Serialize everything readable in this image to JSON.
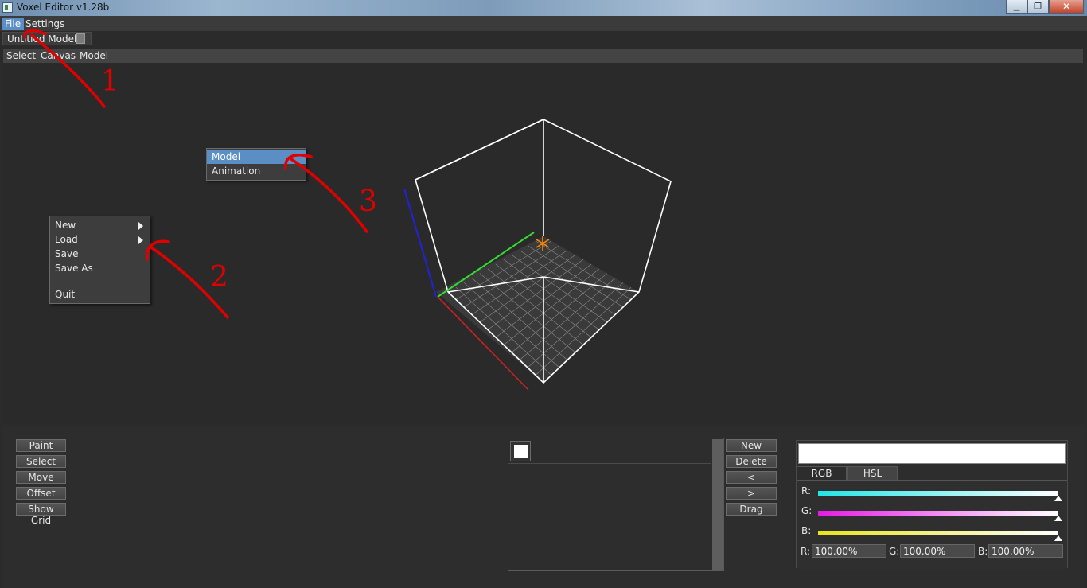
{
  "window": {
    "title": "Voxel Editor v1.28b"
  },
  "menubar": {
    "file": "File",
    "settings": "Settings"
  },
  "document_tab": {
    "title": "Untitled Model"
  },
  "tool_menu": {
    "select": "Select",
    "canvas": "Canvas",
    "model": "Model"
  },
  "file_menu": {
    "new": "New",
    "load": "Load",
    "save": "Save",
    "save_as": "Save As",
    "quit": "Quit"
  },
  "load_submenu": {
    "model": "Model",
    "animation": "Animation"
  },
  "annotations": [
    "1",
    "2",
    "3"
  ],
  "tools": {
    "paint": "Paint",
    "select": "Select",
    "move": "Move",
    "offset": "Offset",
    "show_grid": "Show Grid"
  },
  "frame_buttons": {
    "new": "New",
    "delete": "Delete",
    "prev": "<",
    "next": ">",
    "drag": "Drag"
  },
  "color": {
    "current": "#ffffff",
    "tabs": {
      "rgb": "RGB",
      "hsl": "HSL"
    },
    "sliders": {
      "r": {
        "label": "R:",
        "value_label": "R:",
        "value": "100.00%"
      },
      "g": {
        "label": "G:",
        "value_label": "G:",
        "value": "100.00%"
      },
      "b": {
        "label": "B:",
        "value_label": "B:",
        "value": "100.00%"
      }
    }
  },
  "icons": {
    "app": "voxel-app-icon",
    "minimize": "minimize-icon",
    "maximize": "maximize-icon",
    "close": "close-icon",
    "submenu": "chevron-right-icon",
    "origin": "origin-asterisk-icon"
  },
  "colors": {
    "menu_highlight": "#5b8ec4",
    "axis_x": "#cc2222",
    "axis_y": "#2222dd",
    "axis_z": "#33dd33",
    "annotation": "#e00000",
    "origin": "#ff8800"
  }
}
